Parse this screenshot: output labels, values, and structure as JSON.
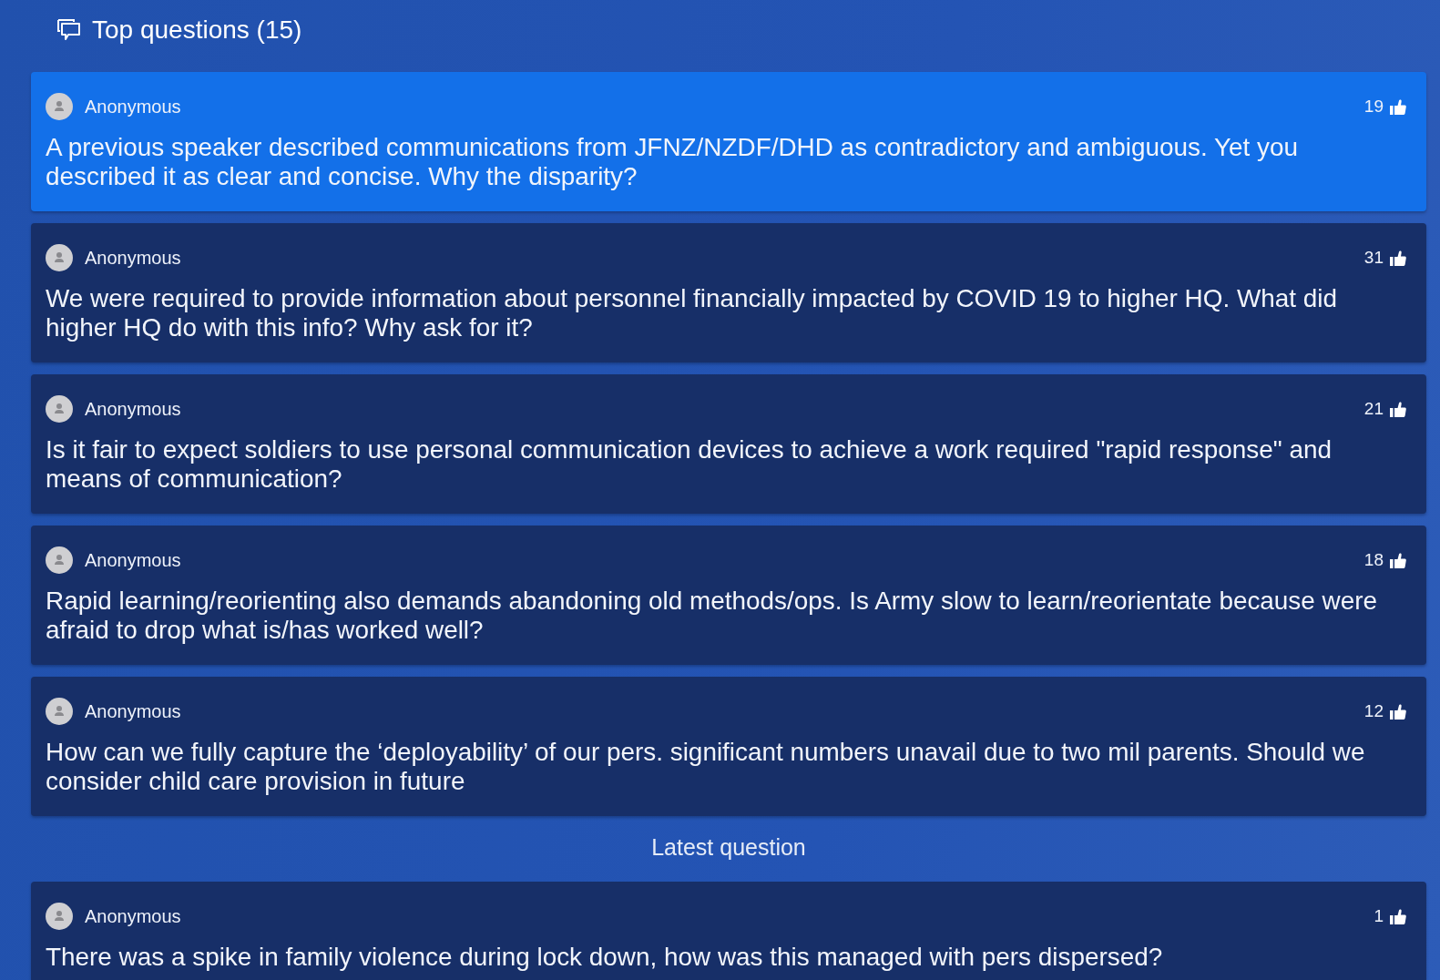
{
  "header": {
    "title": "Top questions (15)"
  },
  "top_questions": [
    {
      "author": "Anonymous",
      "votes": "19",
      "selected": true,
      "text": "A previous speaker described communications from JFNZ/NZDF/DHD as contradictory and ambiguous. Yet you described it as clear and concise. Why the disparity?"
    },
    {
      "author": "Anonymous",
      "votes": "31",
      "selected": false,
      "text": "We were required to provide information about personnel financially impacted by COVID 19 to higher HQ. What did higher HQ do with this info? Why ask for it?"
    },
    {
      "author": "Anonymous",
      "votes": "21",
      "selected": false,
      "text": "Is it fair to expect soldiers to use personal communication devices to achieve a work required \"rapid response\" and means of communication?"
    },
    {
      "author": "Anonymous",
      "votes": "18",
      "selected": false,
      "text": "Rapid learning/reorienting also demands abandoning old methods/ops. Is Army slow to learn/reorientate because were afraid to drop what is/has worked well?"
    },
    {
      "author": "Anonymous",
      "votes": "12",
      "selected": false,
      "text": "How can we fully capture the ‘deployability’ of our pers. significant numbers unavail due to two mil parents. Should we consider child care provision in future"
    }
  ],
  "latest": {
    "label": "Latest question",
    "questions": [
      {
        "author": "Anonymous",
        "votes": "1",
        "selected": false,
        "text": "There was a spike in family violence during lock down, how was this managed with pers dispersed?"
      }
    ]
  }
}
